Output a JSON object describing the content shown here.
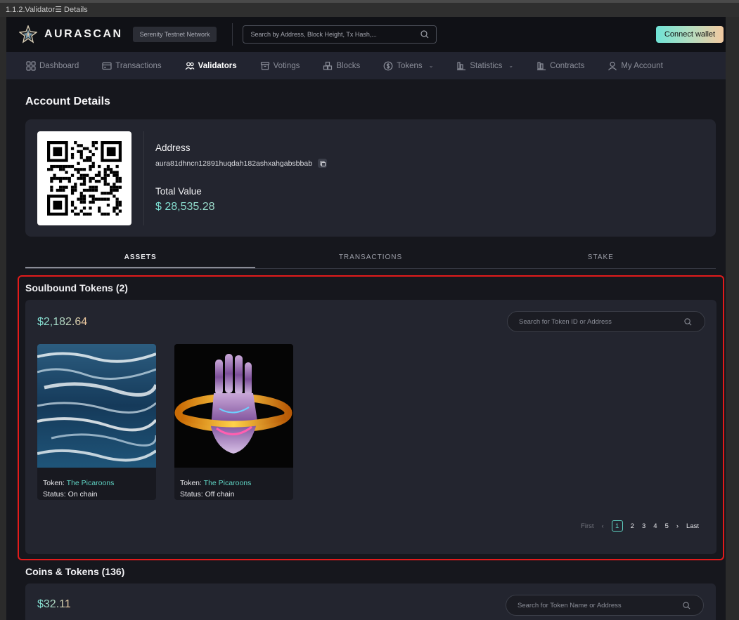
{
  "window": {
    "title": "1.1.2.Validator☰ Details"
  },
  "header": {
    "logo_text": "AURASCAN",
    "network": "Serenity Testnet Network",
    "search_placeholder": "Search by Address, Block Height, Tx Hash,...",
    "connect_label": "Connect wallet"
  },
  "nav": [
    {
      "label": "Dashboard",
      "icon": "grid-icon",
      "active": false
    },
    {
      "label": "Transactions",
      "icon": "card-icon",
      "active": false
    },
    {
      "label": "Validators",
      "icon": "users-icon",
      "active": true
    },
    {
      "label": "Votings",
      "icon": "box-icon",
      "active": false
    },
    {
      "label": "Blocks",
      "icon": "blocks-icon",
      "active": false
    },
    {
      "label": "Tokens",
      "icon": "coin-icon",
      "active": false,
      "dropdown": true
    },
    {
      "label": "Statistics",
      "icon": "chart-icon",
      "active": false,
      "dropdown": true
    },
    {
      "label": "Contracts",
      "icon": "contract-icon",
      "active": false
    },
    {
      "label": "My Account",
      "icon": "user-icon",
      "active": false
    }
  ],
  "account": {
    "page_title": "Account Details",
    "address_label": "Address",
    "address": "aura81dhncn12891huqdah182ashxahgabsbbab",
    "total_value_label": "Total Value",
    "total_value": "$ 28,535.28"
  },
  "tabs": [
    {
      "label": "ASSETS",
      "active": true
    },
    {
      "label": "TRANSACTIONS",
      "active": false
    },
    {
      "label": "STAKE",
      "active": false
    }
  ],
  "soulbound": {
    "title": "Soulbound Tokens (2)",
    "total": "$2,182.64",
    "search_placeholder": "Search for Token ID or Address",
    "tokens": [
      {
        "token_label": "Token:",
        "token_name": "The Picaroons",
        "status_label": "Status:",
        "status": "On chain",
        "image": "ocean-painting"
      },
      {
        "token_label": "Token:",
        "token_name": "The Picaroons",
        "status_label": "Status:",
        "status": "Off chain",
        "image": "chrome-hand"
      }
    ],
    "pagination": {
      "first": "First",
      "pages": [
        "1",
        "2",
        "3",
        "4",
        "5"
      ],
      "current": "1",
      "last": "Last"
    }
  },
  "coins": {
    "title": "Coins & Tokens (136)",
    "total": "$32.11",
    "search_placeholder": "Search for Token Name or Address"
  },
  "colors": {
    "accent": "#5fd3c3",
    "highlight_border": "#e21b1b",
    "connect_gradient_end": "#f3c9a0"
  }
}
